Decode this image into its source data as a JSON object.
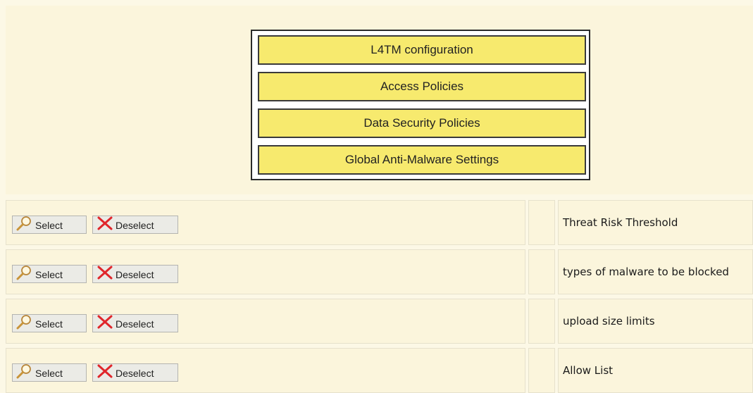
{
  "options": [
    {
      "label": "L4TM configuration"
    },
    {
      "label": "Access Policies"
    },
    {
      "label": "Data Security Policies"
    },
    {
      "label": "Global Anti-Malware Settings"
    }
  ],
  "rows": [
    {
      "select_label": "Select",
      "deselect_label": "Deselect",
      "text": "Threat Risk Threshold"
    },
    {
      "select_label": "Select",
      "deselect_label": "Deselect",
      "text": "types of malware to be blocked"
    },
    {
      "select_label": "Select",
      "deselect_label": "Deselect",
      "text": "upload size limits"
    },
    {
      "select_label": "Select",
      "deselect_label": "Deselect",
      "text": "Allow List"
    }
  ],
  "icons": {
    "select": "magnifier-icon",
    "deselect": "red-x-icon"
  },
  "colors": {
    "option_fill": "#f7ea6e",
    "background": "#fbf5dc",
    "deselect_icon": "#e0262b",
    "select_icon": "#c8943a"
  }
}
